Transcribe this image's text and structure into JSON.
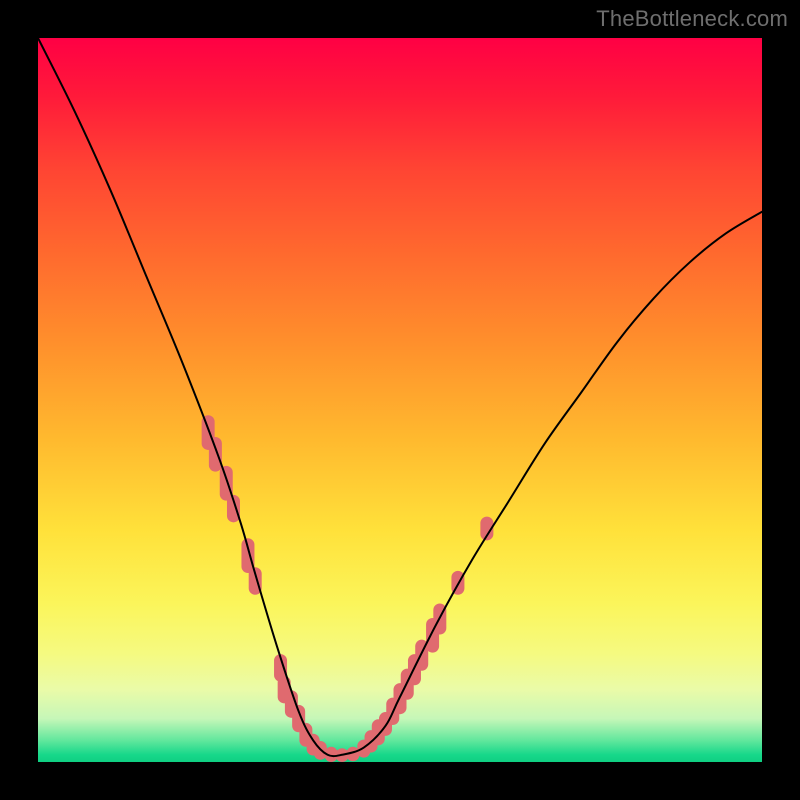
{
  "watermark": "TheBottleneck.com",
  "colors": {
    "curve": "#000000",
    "marker": "#e06a6f",
    "gradient_top": "#ff0044",
    "gradient_bottom": "#0fcf82"
  },
  "chart_data": {
    "type": "line",
    "title": "",
    "xlabel": "",
    "ylabel": "",
    "xlim": [
      0,
      100
    ],
    "ylim": [
      0,
      100
    ],
    "grid": false,
    "legend": false,
    "series": [
      {
        "name": "bottleneck-curve",
        "x": [
          0,
          5,
          10,
          15,
          20,
          25,
          28,
          30,
          33,
          36,
          38,
          40,
          42,
          45,
          48,
          50,
          55,
          60,
          65,
          70,
          75,
          80,
          85,
          90,
          95,
          100
        ],
        "y": [
          100,
          90,
          79,
          67,
          55,
          42,
          33,
          26,
          16,
          7,
          3,
          1,
          1,
          2,
          5,
          9,
          19,
          28,
          36,
          44,
          51,
          58,
          64,
          69,
          73,
          76
        ]
      }
    ],
    "markers": [
      {
        "x": 23.5,
        "y_top": 47,
        "y_bot": 44
      },
      {
        "x": 24.5,
        "y_top": 44,
        "y_bot": 41
      },
      {
        "x": 26.0,
        "y_top": 40,
        "y_bot": 37
      },
      {
        "x": 27.0,
        "y_top": 36,
        "y_bot": 34
      },
      {
        "x": 29.0,
        "y_top": 30,
        "y_bot": 27
      },
      {
        "x": 30.0,
        "y_top": 26,
        "y_bot": 24
      },
      {
        "x": 33.5,
        "y_top": 14,
        "y_bot": 12
      },
      {
        "x": 34.0,
        "y_top": 11,
        "y_bot": 9
      },
      {
        "x": 35.0,
        "y_top": 9,
        "y_bot": 7
      },
      {
        "x": 36.0,
        "y_top": 7,
        "y_bot": 5
      },
      {
        "x": 37.0,
        "y_top": 4.5,
        "y_bot": 3
      },
      {
        "x": 38.0,
        "y_top": 3,
        "y_bot": 1.8
      },
      {
        "x": 39.0,
        "y_top": 2,
        "y_bot": 1.2
      },
      {
        "x": 40.5,
        "y_top": 1.2,
        "y_bot": 0.9
      },
      {
        "x": 42.0,
        "y_top": 1.0,
        "y_bot": 0.9
      },
      {
        "x": 43.5,
        "y_top": 1.2,
        "y_bot": 1.0
      },
      {
        "x": 45.0,
        "y_top": 2.2,
        "y_bot": 1.5
      },
      {
        "x": 46.0,
        "y_top": 3.5,
        "y_bot": 2.2
      },
      {
        "x": 47.0,
        "y_top": 5.0,
        "y_bot": 3.2
      },
      {
        "x": 48.0,
        "y_top": 6.0,
        "y_bot": 4.5
      },
      {
        "x": 49.0,
        "y_top": 8.0,
        "y_bot": 6.0
      },
      {
        "x": 50.0,
        "y_top": 10.0,
        "y_bot": 7.5
      },
      {
        "x": 51.0,
        "y_top": 12.0,
        "y_bot": 9.5
      },
      {
        "x": 52.0,
        "y_top": 14.0,
        "y_bot": 11.5
      },
      {
        "x": 53.0,
        "y_top": 16.0,
        "y_bot": 13.5
      },
      {
        "x": 54.5,
        "y_top": 19.0,
        "y_bot": 16.0
      },
      {
        "x": 55.5,
        "y_top": 21.0,
        "y_bot": 18.5
      },
      {
        "x": 58.0,
        "y_top": 25.5,
        "y_bot": 24.0
      },
      {
        "x": 62.0,
        "y_top": 33.0,
        "y_bot": 31.5
      }
    ]
  }
}
